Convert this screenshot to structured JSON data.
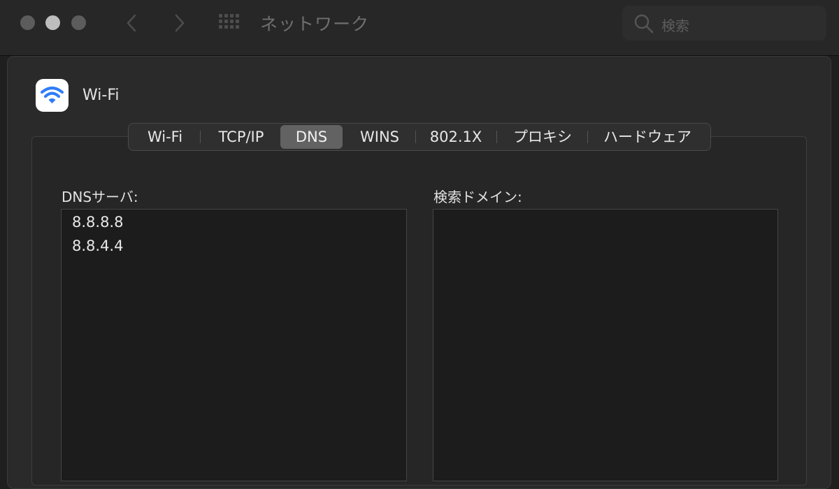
{
  "window": {
    "title": "ネットワーク",
    "search_placeholder": "検索"
  },
  "interface": {
    "name": "Wi-Fi",
    "icon": "wifi-icon",
    "accent": "#2f7cf6"
  },
  "tabs": [
    {
      "label": "Wi-Fi",
      "active": false
    },
    {
      "label": "TCP/IP",
      "active": false
    },
    {
      "label": "DNS",
      "active": true
    },
    {
      "label": "WINS",
      "active": false
    },
    {
      "label": "802.1X",
      "active": false
    },
    {
      "label": "プロキシ",
      "active": false
    },
    {
      "label": "ハードウェア",
      "active": false
    }
  ],
  "dns": {
    "servers_label": "DNSサーバ:",
    "servers": [
      "8.8.8.8",
      "8.8.4.4"
    ],
    "search_domains_label": "検索ドメイン:",
    "search_domains": []
  }
}
